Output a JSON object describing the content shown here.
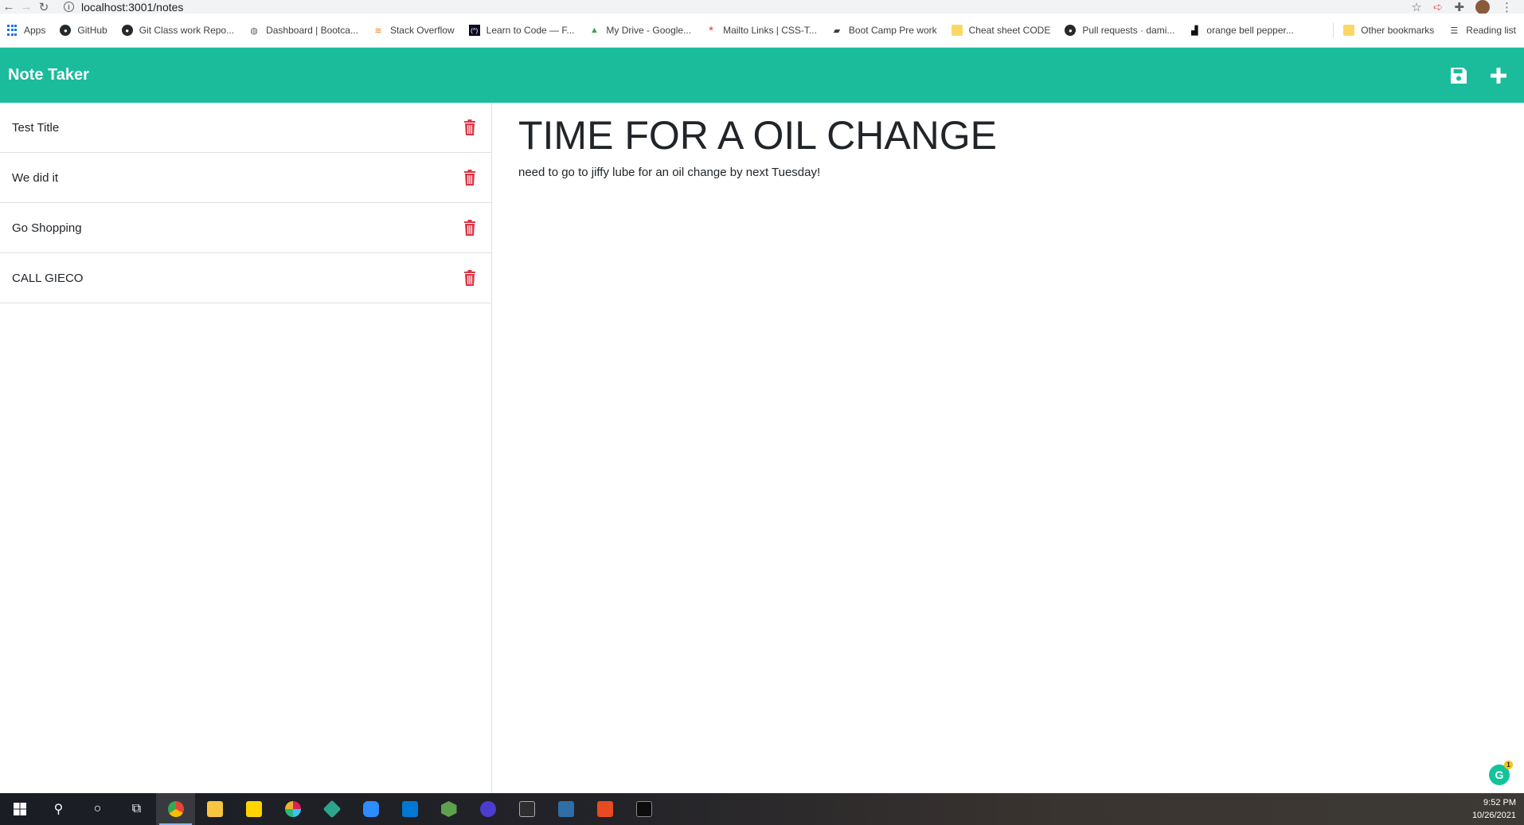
{
  "browser": {
    "url": "localhost:3001/notes",
    "bookmarks": [
      {
        "label": "Apps",
        "icon": "apps-grid-icon"
      },
      {
        "label": "GitHub",
        "icon": "github-icon"
      },
      {
        "label": "Git Class work Repo...",
        "icon": "github-icon"
      },
      {
        "label": "Dashboard | Bootca...",
        "icon": "globe-icon"
      },
      {
        "label": "Stack Overflow",
        "icon": "stack-overflow-icon"
      },
      {
        "label": "Learn to Code — F...",
        "icon": "fcc-icon"
      },
      {
        "label": "My Drive - Google...",
        "icon": "drive-icon"
      },
      {
        "label": "Mailto Links | CSS-T...",
        "icon": "asterisk-icon"
      },
      {
        "label": "Boot Camp Pre work",
        "icon": "book-icon"
      },
      {
        "label": "Cheat sheet CODE",
        "icon": "folder-icon"
      },
      {
        "label": "Pull requests · dami...",
        "icon": "github-icon"
      },
      {
        "label": "orange bell pepper...",
        "icon": "unsplash-icon"
      }
    ],
    "other_bookmarks": "Other bookmarks",
    "reading_list": "Reading list"
  },
  "app": {
    "brand": "Note Taker",
    "accent": "#1abc9c",
    "trash_color": "#dc3545"
  },
  "notes": [
    {
      "title": "Test Title"
    },
    {
      "title": "We did it"
    },
    {
      "title": "Go Shopping"
    },
    {
      "title": "CALL GIECO"
    }
  ],
  "editor": {
    "title": "TIME FOR A OIL CHANGE",
    "text": "need to go to jiffy lube for an oil change by next Tuesday!",
    "grammarly_badge": "1"
  },
  "taskbar": {
    "time": "9:52 PM",
    "date": "10/26/2021"
  }
}
